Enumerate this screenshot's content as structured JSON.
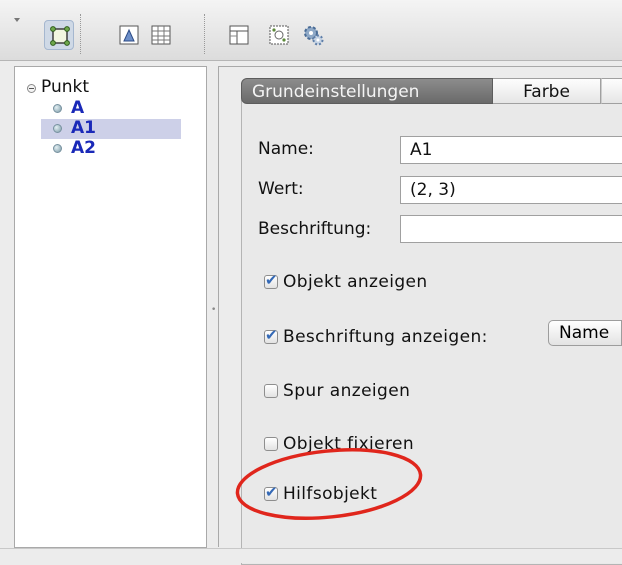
{
  "toolbar": {
    "icons": [
      "algebra-view-icon",
      "graphics-view-icon",
      "spreadsheet-view-icon",
      "layout-icon",
      "construction-icon",
      "settings-icon"
    ]
  },
  "tree": {
    "root_label": "Punkt",
    "items": [
      {
        "label": "A",
        "selected": false
      },
      {
        "label": "A1",
        "selected": true
      },
      {
        "label": "A2",
        "selected": false
      }
    ]
  },
  "tabs": {
    "basic": "Grundeinstellungen",
    "color": "Farbe"
  },
  "fields": {
    "name_label": "Name:",
    "name_value": "A1",
    "value_label": "Wert:",
    "value_value": "(2, 3)",
    "caption_label": "Beschriftung:",
    "caption_value": ""
  },
  "checkboxes": [
    {
      "label": "Objekt anzeigen",
      "checked": true
    },
    {
      "label": "Beschriftung anzeigen:",
      "checked": true
    },
    {
      "label": "Spur anzeigen",
      "checked": false
    },
    {
      "label": "Objekt fixieren",
      "checked": false
    },
    {
      "label": "Hilfsobjekt",
      "checked": true
    }
  ],
  "label_mode": "Name",
  "colors": {
    "highlight_ellipse": "#e0261c",
    "tree_text": "#1a29b8",
    "check_mark": "#3469b6"
  }
}
